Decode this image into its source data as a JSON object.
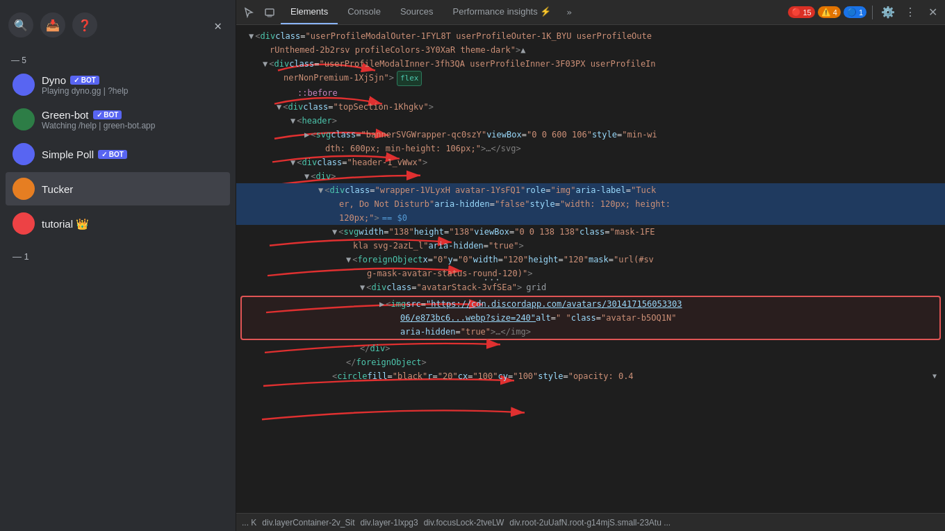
{
  "sidebar": {
    "icons": [
      "search",
      "inbox",
      "help"
    ],
    "close_label": "✕",
    "divider_label": "— 5",
    "items": [
      {
        "name": "Dyno",
        "sub": "Playing dyno.gg | ?help",
        "badge": "BOT",
        "avatar_color": "#5865f2"
      },
      {
        "name": "Green-bot",
        "sub": "Watching /help | green-bot.app",
        "badge": "BOT",
        "avatar_color": "#2d7d46"
      },
      {
        "name": "Simple Poll",
        "sub": "",
        "badge": "BOT",
        "avatar_color": "#5865f2"
      },
      {
        "name": "Tucker",
        "sub": "",
        "badge": "",
        "avatar_color": "#e67e22"
      },
      {
        "name": "tutorial 👑",
        "sub": "",
        "badge": "",
        "avatar_color": "#ed4245"
      }
    ],
    "bottom_num": "— 1"
  },
  "devtools": {
    "tabs": [
      "Elements",
      "Console",
      "Sources",
      "Performance insights ⚡",
      "»"
    ],
    "active_tab": "Elements",
    "badges": {
      "errors": "15",
      "warnings": "4",
      "info": "1"
    },
    "toolbar_icons": [
      "cursor-icon",
      "box-icon",
      "settings-icon",
      "dots-icon",
      "close-icon"
    ]
  },
  "code": {
    "lines": [
      {
        "id": 1,
        "indent": 0,
        "content": "<div class=\"userProfileModalOuter-1FYL8T userProfileOuter-1K_BYU userProfileOute",
        "content2": "rUnthemed-2b2rsv profileColors-3Y0XaR theme-dark\">",
        "type": "open"
      },
      {
        "id": 2,
        "indent": 1,
        "content": "<div class=\"userProfileModalInner-3fh3QA userProfileInner-3F03PX userProfileIn",
        "content2": "nerNonPremium-1XjSjn\">",
        "badge": "flex",
        "type": "open"
      },
      {
        "id": 3,
        "indent": 2,
        "content": "::before",
        "type": "pseudo"
      },
      {
        "id": 4,
        "indent": 1,
        "content": "<div class=\"topSection-1Khgkv\">",
        "type": "open"
      },
      {
        "id": 5,
        "indent": 2,
        "content": "<header>",
        "type": "open"
      },
      {
        "id": 6,
        "indent": 3,
        "content": "<svg class=\"bannerSVGWrapper-qc0szY\" viewBox=\"0 0 600 106\" style=\"min-wi",
        "content2": "dth: 600px; min-height: 106px;\">…</svg>",
        "type": "open"
      },
      {
        "id": 7,
        "indent": 2,
        "content": "<div class=\"header-1_vWwx\">",
        "type": "open"
      },
      {
        "id": 8,
        "indent": 3,
        "content": "<div>",
        "type": "open"
      },
      {
        "id": 9,
        "indent": 4,
        "content": "<div class=\"wrapper-1VLyxH avatar-1YsFQ1\" role=\"img\" aria-label=\"Tuck",
        "content2": "er, Do Not Disturb\" aria-hidden=\"false\" style=\"width: 120px; height:",
        "content3": "120px;\"> == $0",
        "type": "selected",
        "eq": true
      },
      {
        "id": 10,
        "indent": 4,
        "content": "<svg width=\"138\" height=\"138\" viewBox=\"0 0 138 138\" class=\"mask-1FE",
        "content2": "kla svg-2azL_l\" aria-hidden=\"true\">",
        "type": "open"
      },
      {
        "id": 11,
        "indent": 5,
        "content": "<foreignObject x=\"0\" y=\"0\" width=\"120\" height=\"120\" mask=\"url(#sv",
        "content2": "g-mask-avatar-status-round-120)\">",
        "type": "open"
      },
      {
        "id": 12,
        "indent": 6,
        "content": "<div class=\"avatarStack-3vfSEa\"> grid",
        "type": "open"
      },
      {
        "id": 13,
        "indent": 7,
        "content": "<img src=\"https://cdn.discordapp.com/avatars/301417156053303",
        "content2": "06/e873bc6...webp?size=240\" alt=\" \" class=\"avatar-b5OQ1N\"",
        "content3": "aria-hidden=\"true\">…</img>",
        "type": "red-outline"
      },
      {
        "id": 14,
        "indent": 6,
        "content": "</div>",
        "type": "close"
      },
      {
        "id": 15,
        "indent": 5,
        "content": "</foreignObject>",
        "type": "close"
      },
      {
        "id": 16,
        "indent": 4,
        "content": "<circle fill=\"black\" r=\"20\" cx=\"100\" cy=\"100\" style=\"opacity: 0.4",
        "type": "open"
      }
    ]
  },
  "breadcrumb": {
    "items": [
      "... K",
      "div.layerContainer-2v_Sit",
      "div.layer-1lxpg3",
      "div.focusLock-2tveLW",
      "div.root-2uUafN.root-g14mjS.small-23Atu ..."
    ]
  }
}
